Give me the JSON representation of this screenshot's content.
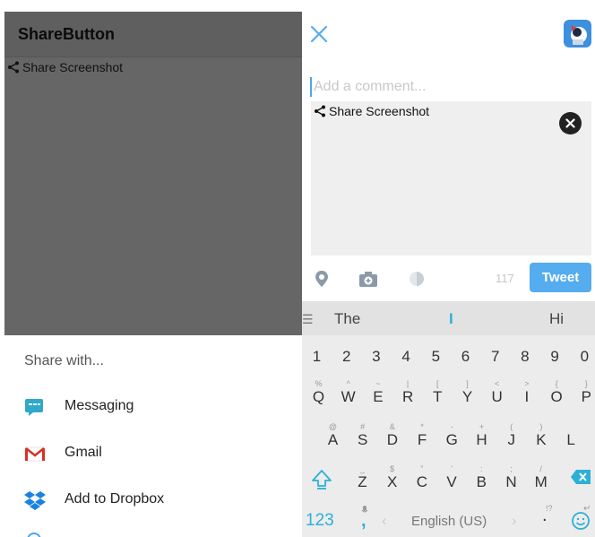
{
  "left": {
    "app_title": "ShareButton",
    "share_link": "Share Screenshot",
    "share_sheet": {
      "title": "Share with...",
      "items": [
        {
          "label": "Messaging",
          "icon": "messaging-icon"
        },
        {
          "label": "Gmail",
          "icon": "gmail-icon"
        },
        {
          "label": "Add to Dropbox",
          "icon": "dropbox-icon"
        }
      ]
    }
  },
  "right": {
    "comment_placeholder": "Add a comment...",
    "attachment_link": "Share Screenshot",
    "char_count": "117",
    "tweet_label": "Tweet",
    "accent_color": "#55acee"
  },
  "keyboard": {
    "suggestions": {
      "left": "The",
      "middle": "I",
      "right": "Hi"
    },
    "number_row": [
      "1",
      "2",
      "3",
      "4",
      "5",
      "6",
      "7",
      "8",
      "9",
      "0"
    ],
    "row1": {
      "keys": [
        "Q",
        "W",
        "E",
        "R",
        "T",
        "Y",
        "U",
        "I",
        "O",
        "P"
      ],
      "hints": [
        "%",
        "^",
        "~",
        "|",
        "[",
        "]",
        "<",
        ">",
        "{",
        "}"
      ]
    },
    "row2": {
      "keys": [
        "A",
        "S",
        "D",
        "F",
        "G",
        "H",
        "J",
        "K",
        "L"
      ],
      "hints": [
        "@",
        "#",
        "&",
        "*",
        "-",
        "+",
        "(",
        ")",
        ""
      ]
    },
    "row3": {
      "keys": [
        "Z",
        "X",
        "C",
        "V",
        "B",
        "N",
        "M"
      ],
      "hints": [
        "_",
        "$",
        "\"",
        "'",
        ":",
        ";",
        "/"
      ]
    },
    "symbols_label": "123",
    "comma": ",",
    "language": "English (US)",
    "period": ".",
    "period_hints": "!?"
  }
}
